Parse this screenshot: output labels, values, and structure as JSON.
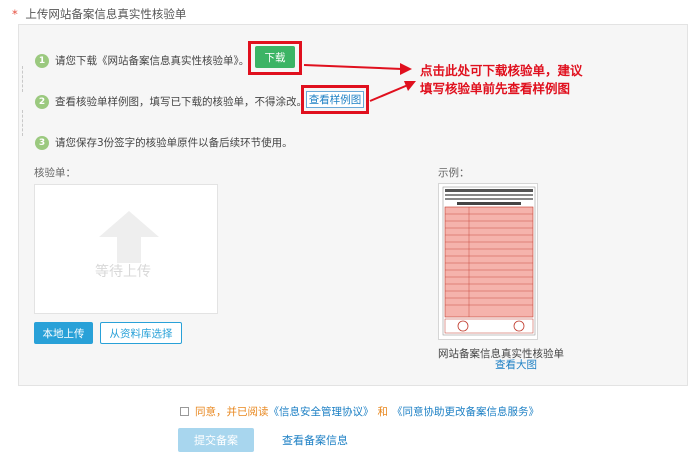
{
  "section": {
    "required_mark": "*",
    "title": "上传网站备案信息真实性核验单"
  },
  "steps": [
    {
      "num": "1",
      "text": "请您下载《网站备案信息真实性核验单》。"
    },
    {
      "num": "2",
      "text": "查看核验单样例图，填写已下载的核验单，不得涂改。"
    },
    {
      "num": "3",
      "text": "请您保存3份签字的核验单原件以备后续环节使用。"
    }
  ],
  "buttons": {
    "download": "下载",
    "view_sample": "查看样例图",
    "local_upload": "本地上传",
    "from_library": "从资料库选择",
    "submit": "提交备案"
  },
  "annotation": {
    "line1": "点击此处可下载核验单，建议",
    "line2": "填写核验单前先查看样例图"
  },
  "upload": {
    "label": "核验单：",
    "placeholder": "等待上传"
  },
  "example": {
    "label": "示例：",
    "title": "网站备案信息真实性核验单",
    "view_large": "查看大图"
  },
  "agreement": {
    "prefix": "同意，并已阅读",
    "link1": "《信息安全管理协议》",
    "and": "和",
    "link2": "《同意协助更改备案信息服务》"
  },
  "footer_link": "查看备案信息",
  "colors": {
    "accent_green": "#3cb465",
    "accent_blue": "#29a1d8",
    "highlight_red": "#e0101e",
    "step_green": "#9bc97f"
  }
}
